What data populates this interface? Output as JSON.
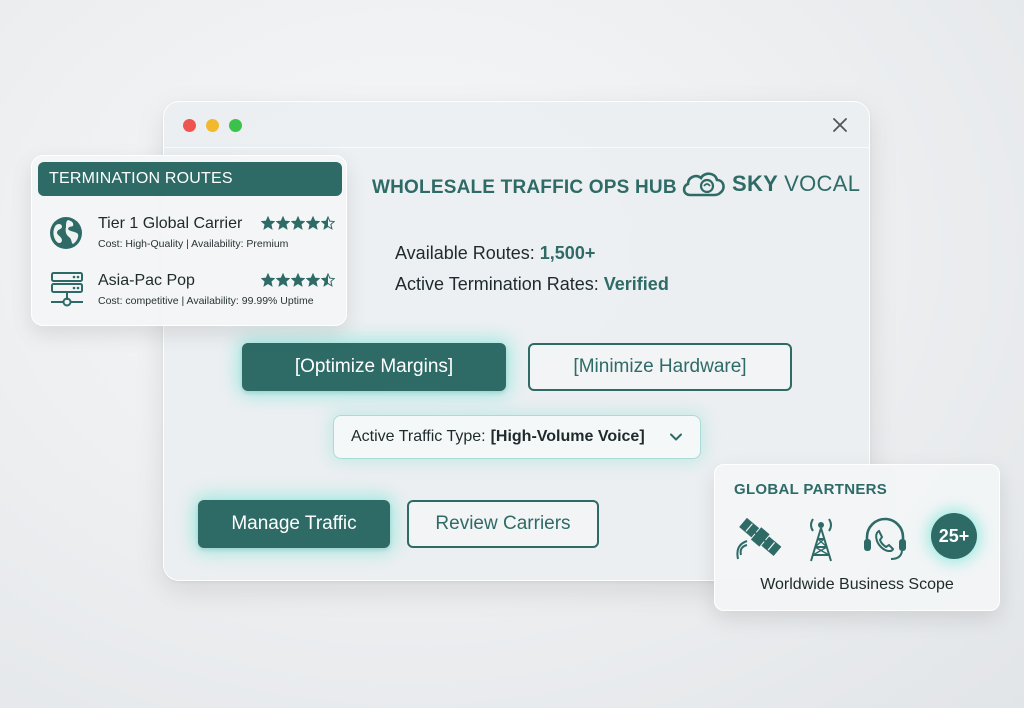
{
  "window": {
    "title": "WHOLESALE TRAFFIC OPS HUB",
    "brand": {
      "sky": "SKY",
      "vocal": "VOCAL"
    },
    "stats": [
      {
        "label": "Available Routes:",
        "value": "1,500+"
      },
      {
        "label": "Active Termination Rates:",
        "value": "Verified"
      }
    ],
    "buttons": {
      "optimize": "[Optimize Margins]",
      "minimize": "[Minimize Hardware]",
      "manage": "Manage Traffic",
      "review": "Review Carriers"
    },
    "dropdown": {
      "label": "Active Traffic Type:",
      "value": "[High-Volume Voice]"
    }
  },
  "termination_card": {
    "title": "TERMINATION ROUTES",
    "routes": [
      {
        "name": "Tier 1 Global Carrier",
        "detail": "Cost: High-Quality | Availability: Premium",
        "rating": 4.5,
        "icon": "globe-icon"
      },
      {
        "name": "Asia-Pac Pop",
        "detail": "Cost: competitive | Availability: 99.99% Uptime",
        "rating": 4.5,
        "icon": "server-icon"
      }
    ]
  },
  "partners_card": {
    "title": "GLOBAL PARTNERS",
    "icons": [
      "satellite-icon",
      "cell-tower-icon",
      "headset-phone-icon"
    ],
    "badge": "25+",
    "caption": "Worldwide Business Scope"
  },
  "colors": {
    "accent": "#2e6b67",
    "glow": "#40e0cc"
  }
}
